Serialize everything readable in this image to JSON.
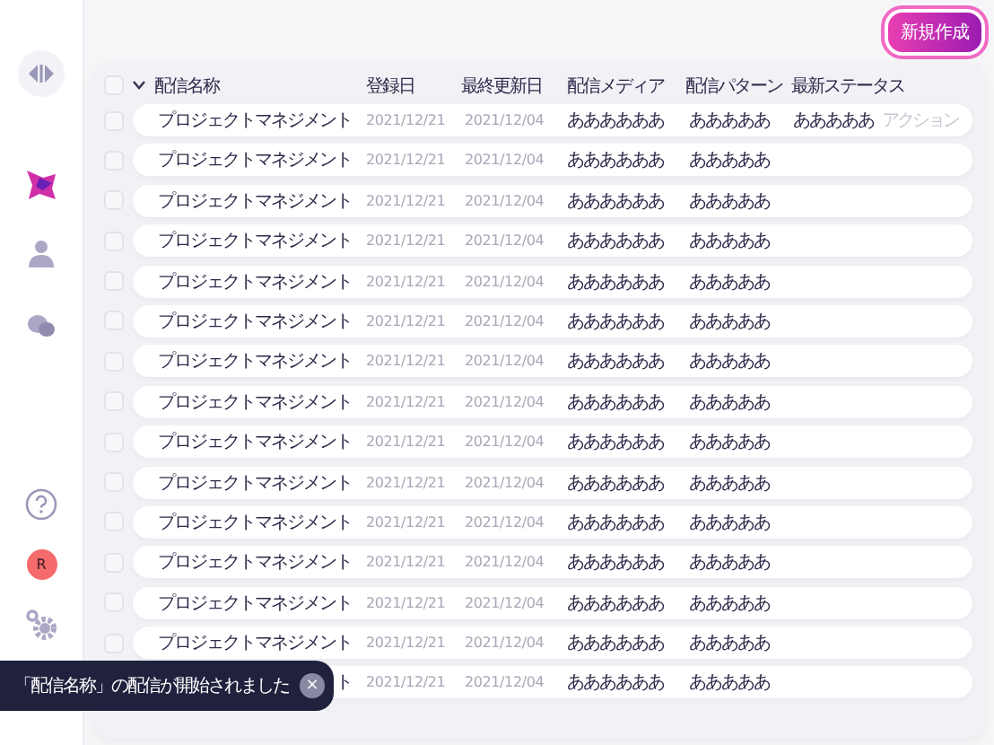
{
  "create_button": "新規作成",
  "table": {
    "header_checkbox": {
      "checked": false
    },
    "columns": [
      "配信名称",
      "登録日",
      "最終更新日",
      "配信メディア",
      "配信パターン",
      "最新ステータス"
    ],
    "rows": [
      {
        "checked": false,
        "name": "プロジェクトマネジメント",
        "registered": "2021/12/21",
        "updated": "2021/12/04",
        "media": "ああああああ",
        "pattern": "あああああ",
        "status": "あああああ",
        "action": "アクション"
      },
      {
        "checked": false,
        "name": "プロジェクトマネジメント",
        "registered": "2021/12/21",
        "updated": "2021/12/04",
        "media": "ああああああ",
        "pattern": "あああああ"
      },
      {
        "checked": false,
        "name": "プロジェクトマネジメント",
        "registered": "2021/12/21",
        "updated": "2021/12/04",
        "media": "ああああああ",
        "pattern": "あああああ"
      },
      {
        "checked": false,
        "name": "プロジェクトマネジメント",
        "registered": "2021/12/21",
        "updated": "2021/12/04",
        "media": "ああああああ",
        "pattern": "あああああ"
      },
      {
        "checked": false,
        "name": "プロジェクトマネジメント",
        "registered": "2021/12/21",
        "updated": "2021/12/04",
        "media": "ああああああ",
        "pattern": "あああああ"
      },
      {
        "checked": false,
        "name": "プロジェクトマネジメント",
        "registered": "2021/12/21",
        "updated": "2021/12/04",
        "media": "ああああああ",
        "pattern": "あああああ"
      },
      {
        "checked": false,
        "name": "プロジェクトマネジメント",
        "registered": "2021/12/21",
        "updated": "2021/12/04",
        "media": "ああああああ",
        "pattern": "あああああ"
      },
      {
        "checked": false,
        "name": "プロジェクトマネジメント",
        "registered": "2021/12/21",
        "updated": "2021/12/04",
        "media": "ああああああ",
        "pattern": "あああああ"
      },
      {
        "checked": false,
        "name": "プロジェクトマネジメント",
        "registered": "2021/12/21",
        "updated": "2021/12/04",
        "media": "ああああああ",
        "pattern": "あああああ"
      },
      {
        "checked": false,
        "name": "プロジェクトマネジメント",
        "registered": "2021/12/21",
        "updated": "2021/12/04",
        "media": "ああああああ",
        "pattern": "あああああ"
      },
      {
        "checked": false,
        "name": "プロジェクトマネジメント",
        "registered": "2021/12/21",
        "updated": "2021/12/04",
        "media": "ああああああ",
        "pattern": "あああああ"
      },
      {
        "checked": false,
        "name": "プロジェクトマネジメント",
        "registered": "2021/12/21",
        "updated": "2021/12/04",
        "media": "ああああああ",
        "pattern": "あああああ"
      },
      {
        "checked": false,
        "name": "プロジェクトマネジメント",
        "registered": "2021/12/21",
        "updated": "2021/12/04",
        "media": "ああああああ",
        "pattern": "あああああ"
      },
      {
        "checked": false,
        "name": "プロジェクトマネジメント",
        "registered": "2021/12/21",
        "updated": "2021/12/04",
        "media": "ああああああ",
        "pattern": "あああああ"
      },
      {
        "name": "ト",
        "registered": "2021/12/21",
        "updated": "2021/12/04",
        "media": "ああああああ",
        "pattern": "あああああ"
      }
    ]
  },
  "sidebar": {
    "avatar": "R"
  },
  "toast": {
    "message": "「配信名称」の配信が開始されました",
    "close": "×"
  }
}
